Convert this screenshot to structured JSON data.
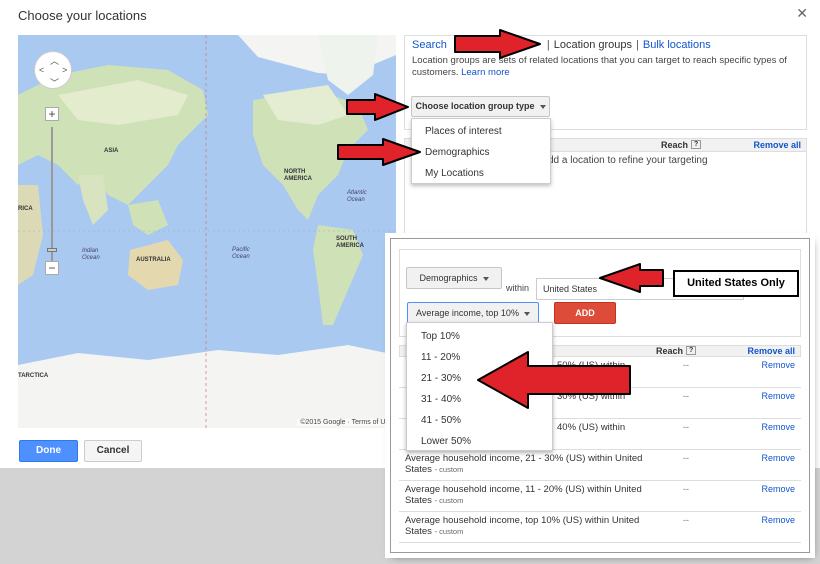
{
  "dialog": {
    "title": "Choose your locations",
    "close": "✕",
    "done": "Done",
    "cancel": "Cancel"
  },
  "map": {
    "labels": {
      "asia": "ASIA",
      "africa": "RICA",
      "north_america": "NORTH AMERICA",
      "south_america": "SOUTH AMERICA",
      "australia": "AUSTRALIA",
      "antarctica": "TARCTICA",
      "indian_ocean": "Indian Ocean",
      "pacific_ocean": "Pacific Ocean",
      "atlantic_ocean": "Atlantic Ocean"
    },
    "footer": "©2015 Google ·   Terms of Us"
  },
  "tabs": {
    "search": "Search",
    "location_groups": "Location groups",
    "bulk_locations": "Bulk locations"
  },
  "description": {
    "text": "Location groups are sets of related locations that you can target to reach specific types of customers.",
    "learn_more": "Learn more"
  },
  "group_type_button": "Choose location group type",
  "group_type_menu": [
    "Places of interest",
    "Demographics",
    "My Locations"
  ],
  "selected": {
    "reach_header": "Reach",
    "help": "?",
    "remove_all": "Remove all",
    "empty_text": "dd a location to refine your targeting"
  },
  "overlay": {
    "demographics_button": "Demographics",
    "within": "within",
    "country": "United States",
    "income_button": "Average income, top 10%",
    "add": "ADD",
    "callout": "United States Only",
    "reach_header": "Reach",
    "help": "?",
    "remove_all": "Remove all",
    "income_menu": [
      "Top 10%",
      "11 - 20%",
      "21 - 30%",
      "31 - 40%",
      "41 - 50%",
      "Lower 50%"
    ],
    "rows": [
      {
        "text": "50% (US) within",
        "custom": "",
        "reach": "--",
        "remove": "Remove"
      },
      {
        "text": "30% (US) within",
        "custom": "",
        "reach": "--",
        "remove": "Remove"
      },
      {
        "text": "40% (US) within",
        "custom": "",
        "reach": "--",
        "remove": "Remove"
      },
      {
        "text": "Average household income, 21 - 30% (US) within United States",
        "custom": "- custom",
        "reach": "--",
        "remove": "Remove"
      },
      {
        "text": "Average household income, 11 - 20% (US) within United States",
        "custom": "- custom",
        "reach": "--",
        "remove": "Remove"
      },
      {
        "text": "Average household income, top 10% (US) within United States",
        "custom": "- custom",
        "reach": "--",
        "remove": "Remove"
      }
    ]
  },
  "colors": {
    "link": "#1155cc",
    "done_blue": "#4d90fe",
    "add_red": "#dd4b39",
    "arrow_red": "#e0222a"
  }
}
